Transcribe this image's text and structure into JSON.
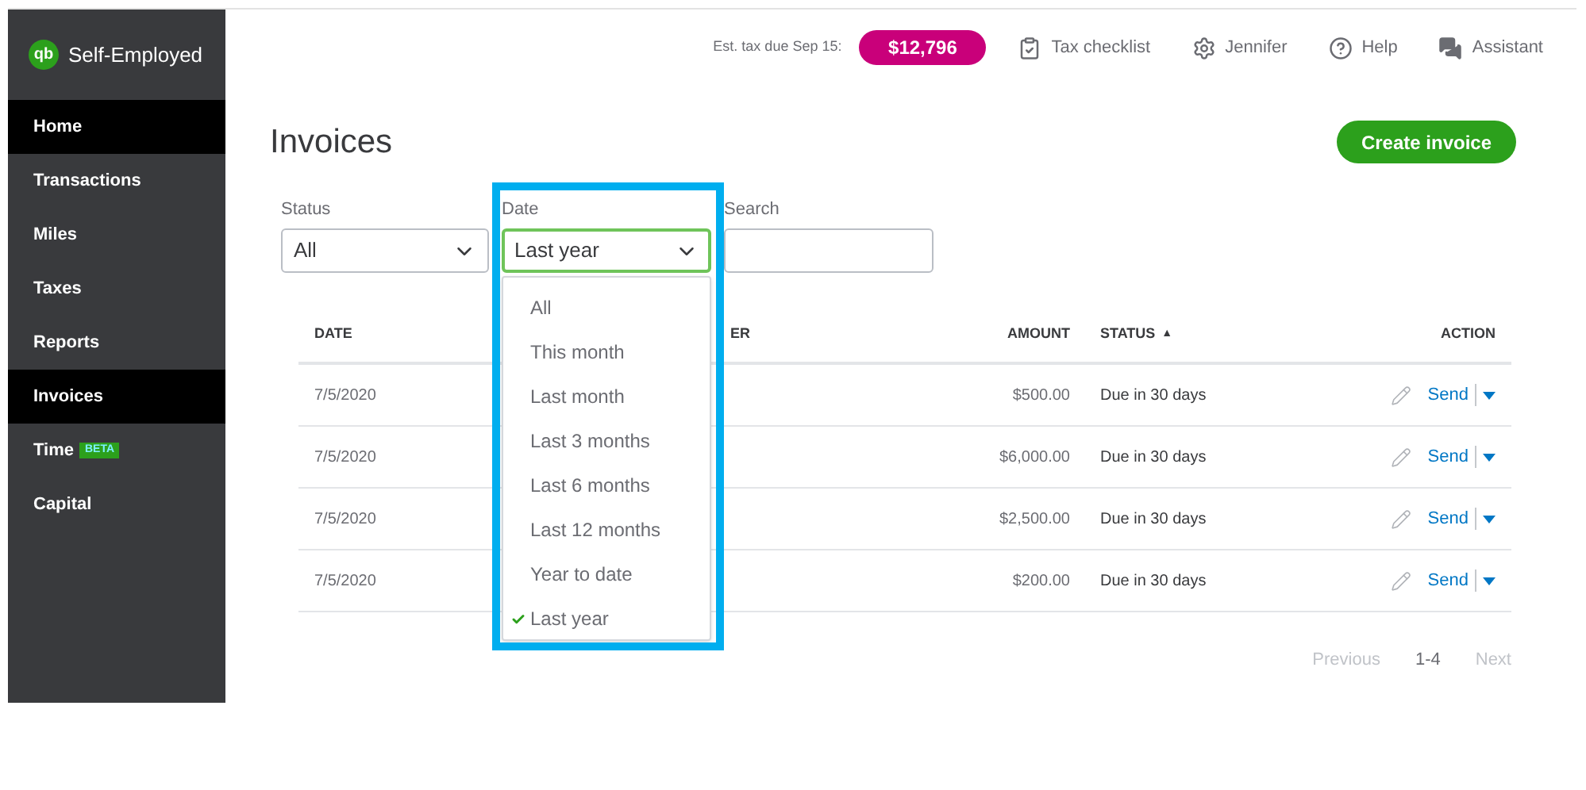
{
  "sidebar": {
    "logo": {
      "mark": "qb",
      "label": "Self-Employed"
    },
    "items": [
      {
        "label": "Home",
        "selected": true
      },
      {
        "label": "Transactions",
        "selected": false
      },
      {
        "label": "Miles",
        "selected": false
      },
      {
        "label": "Taxes",
        "selected": false
      },
      {
        "label": "Reports",
        "selected": false
      },
      {
        "label": "Invoices",
        "selected": true
      },
      {
        "label": "Time",
        "selected": false,
        "badge": "BETA"
      },
      {
        "label": "Capital",
        "selected": false
      }
    ]
  },
  "topbar": {
    "tax_label": "Est. tax due Sep 15:",
    "tax_amount": "$12,796",
    "links": [
      {
        "kind": "checklist",
        "label": "Tax checklist"
      },
      {
        "kind": "gear",
        "label": "Jennifer"
      },
      {
        "kind": "help",
        "label": "Help"
      },
      {
        "kind": "chat",
        "label": "Assistant"
      }
    ]
  },
  "page": {
    "title": "Invoices",
    "create_button": "Create invoice"
  },
  "filters": {
    "status": {
      "label": "Status",
      "value": "All"
    },
    "date": {
      "label": "Date",
      "value": "Last year",
      "open": true
    },
    "search": {
      "label": "Search"
    }
  },
  "date_options": [
    {
      "label": "All",
      "selected": false
    },
    {
      "label": "This month",
      "selected": false
    },
    {
      "label": "Last month",
      "selected": false
    },
    {
      "label": "Last 3 months",
      "selected": false
    },
    {
      "label": "Last 6 months",
      "selected": false
    },
    {
      "label": "Last 12 months",
      "selected": false
    },
    {
      "label": "Year to date",
      "selected": false
    },
    {
      "label": "Last year",
      "selected": true
    }
  ],
  "table": {
    "columns": {
      "date": "DATE",
      "column_3": "ER",
      "amount": "AMOUNT",
      "status": "STATUS",
      "status_sort": "▲",
      "action": "ACTION"
    },
    "rows": [
      {
        "date": "7/5/2020",
        "amount": "$500.00",
        "status": "Due in 30 days",
        "action": "Send"
      },
      {
        "date": "7/5/2020",
        "amount": "$6,000.00",
        "status": "Due in 30 days",
        "action": "Send"
      },
      {
        "date": "7/5/2020",
        "amount": "$2,500.00",
        "status": "Due in 30 days",
        "action": "Send"
      },
      {
        "date": "7/5/2020",
        "amount": "$200.00",
        "status": "Due in 30 days",
        "action": "Send"
      }
    ]
  },
  "pagination": {
    "previous": "Previous",
    "range": "1-4",
    "next": "Next"
  }
}
